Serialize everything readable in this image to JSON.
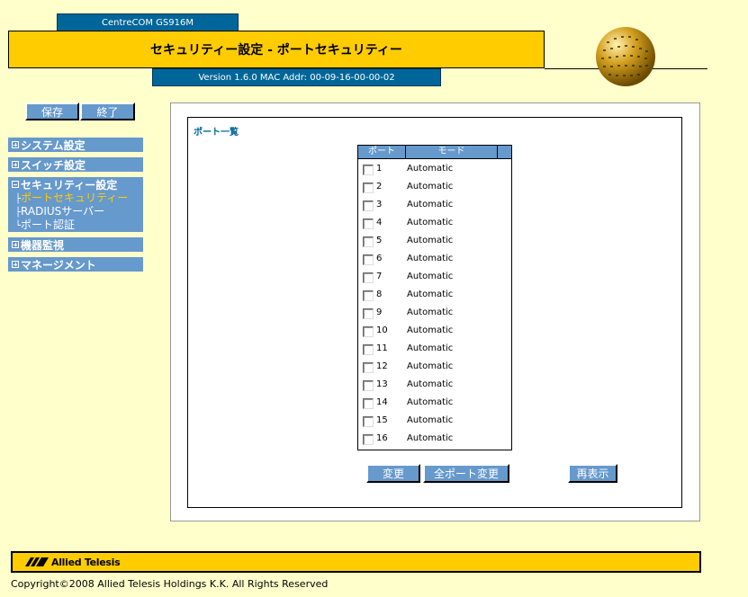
{
  "header": {
    "device": "CentreCOM GS916M",
    "title": "セキュリティー設定 - ポートセキュリティー",
    "version": "Version 1.6.0 MAC Addr: 00-09-16-00-00-02"
  },
  "buttons": {
    "save": "保存",
    "exit": "終了",
    "change": "変更",
    "change_all": "全ポート変更",
    "refresh": "再表示"
  },
  "menu": {
    "system": "システム設定",
    "switch": "スイッチ設定",
    "security": "セキュリティー設定",
    "security_items": [
      "ポートセキュリティー",
      "RADIUSサーバー",
      "ポート認証"
    ],
    "monitor": "機器監視",
    "management": "マネージメント"
  },
  "main": {
    "section_title": "ポート一覧",
    "col_port": "ポート",
    "col_mode": "モード",
    "ports": [
      {
        "num": "1",
        "mode": "Automatic"
      },
      {
        "num": "2",
        "mode": "Automatic"
      },
      {
        "num": "3",
        "mode": "Automatic"
      },
      {
        "num": "4",
        "mode": "Automatic"
      },
      {
        "num": "5",
        "mode": "Automatic"
      },
      {
        "num": "6",
        "mode": "Automatic"
      },
      {
        "num": "7",
        "mode": "Automatic"
      },
      {
        "num": "8",
        "mode": "Automatic"
      },
      {
        "num": "9",
        "mode": "Automatic"
      },
      {
        "num": "10",
        "mode": "Automatic"
      },
      {
        "num": "11",
        "mode": "Automatic"
      },
      {
        "num": "12",
        "mode": "Automatic"
      },
      {
        "num": "13",
        "mode": "Automatic"
      },
      {
        "num": "14",
        "mode": "Automatic"
      },
      {
        "num": "15",
        "mode": "Automatic"
      },
      {
        "num": "16",
        "mode": "Automatic"
      }
    ]
  },
  "footer": {
    "logo": "Allied Telesis",
    "copyright": "Copyright©2008 Allied Telesis Holdings K.K. All Rights Reserved"
  },
  "colors": {
    "background": "#ffffcc",
    "accent": "#ffcc00",
    "nav": "#6699cc",
    "header_blue": "#006699"
  }
}
